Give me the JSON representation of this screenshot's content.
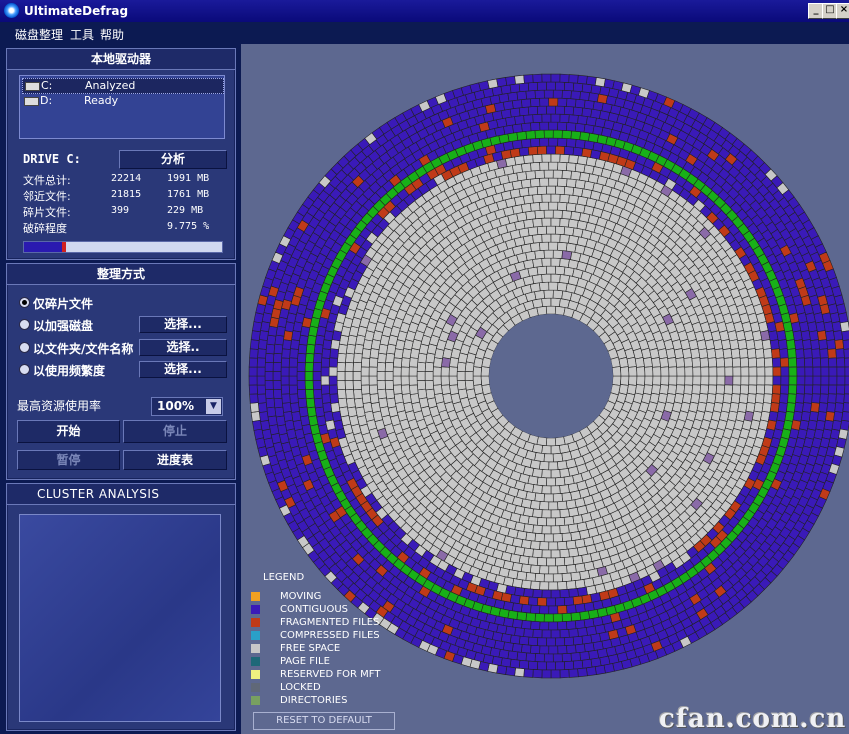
{
  "window": {
    "title": "UltimateDefrag"
  },
  "window_buttons": {
    "minimize": "_",
    "maximize": "□",
    "close": "×"
  },
  "menu": {
    "items": [
      "磁盘整理",
      "工具",
      "帮助"
    ]
  },
  "local_drives": {
    "header": "本地驱动器",
    "drives": [
      {
        "letter": "C:",
        "status": "Analyzed",
        "selected": true
      },
      {
        "letter": "D:",
        "status": "Ready",
        "selected": false
      }
    ],
    "drive_label": "DRIVE C:",
    "analyze_label": "分析",
    "stats": [
      {
        "label": "文件总计:",
        "count": "22214",
        "size": "1991 MB"
      },
      {
        "label": "邻近文件:",
        "count": "21815",
        "size": "1761 MB"
      },
      {
        "label": "碎片文件:",
        "count": "399",
        "size": "229 MB"
      },
      {
        "label": "破碎程度",
        "count": "",
        "size": "9.775 %"
      }
    ],
    "frag_progress": 0.21
  },
  "method": {
    "header": "整理方式",
    "options": [
      {
        "label": "仅碎片文件",
        "checked": true,
        "button": ""
      },
      {
        "label": "以加强磁盘",
        "checked": false,
        "button": "选择..."
      },
      {
        "label": "以文件夹/文件名称",
        "checked": false,
        "button": "选择.."
      },
      {
        "label": "以使用频繁度",
        "checked": false,
        "button": "选择..."
      }
    ],
    "resource_label": "最高资源使用率",
    "resource_value": "100%",
    "start_label": "开始",
    "stop_label": "停止",
    "pause_label": "暂停",
    "progress_label": "进度表"
  },
  "cluster_analysis": {
    "header": "CLUSTER ANALYSIS"
  },
  "legend": {
    "title": "LEGEND",
    "items": [
      {
        "label": "MOVING",
        "color": "#f0a020"
      },
      {
        "label": "CONTIGUOUS",
        "color": "#3a1ab8"
      },
      {
        "label": "FRAGMENTED FILES",
        "color": "#c03a18"
      },
      {
        "label": "COMPRESSED FILES",
        "color": "#2aa0c8"
      },
      {
        "label": "FREE SPACE",
        "color": "#c8c8c8"
      },
      {
        "label": "PAGE FILE",
        "color": "#1e6878"
      },
      {
        "label": "RESERVED FOR MFT",
        "color": "#f0f080"
      },
      {
        "label": "LOCKED",
        "color": "#606878"
      },
      {
        "label": "DIRECTORIES",
        "color": "#78a060"
      }
    ],
    "reset_label": "RESET TO DEFAULT"
  },
  "watermark": "cfan.com.cn",
  "colors": {
    "contiguous": "#3a1ab8",
    "fragmented": "#c03a18",
    "directories_ring": "#18b018",
    "free": "#c8c8c8",
    "locked": "#8a6aa8",
    "grid": "#222222",
    "disk_bg": "#5d6890"
  }
}
